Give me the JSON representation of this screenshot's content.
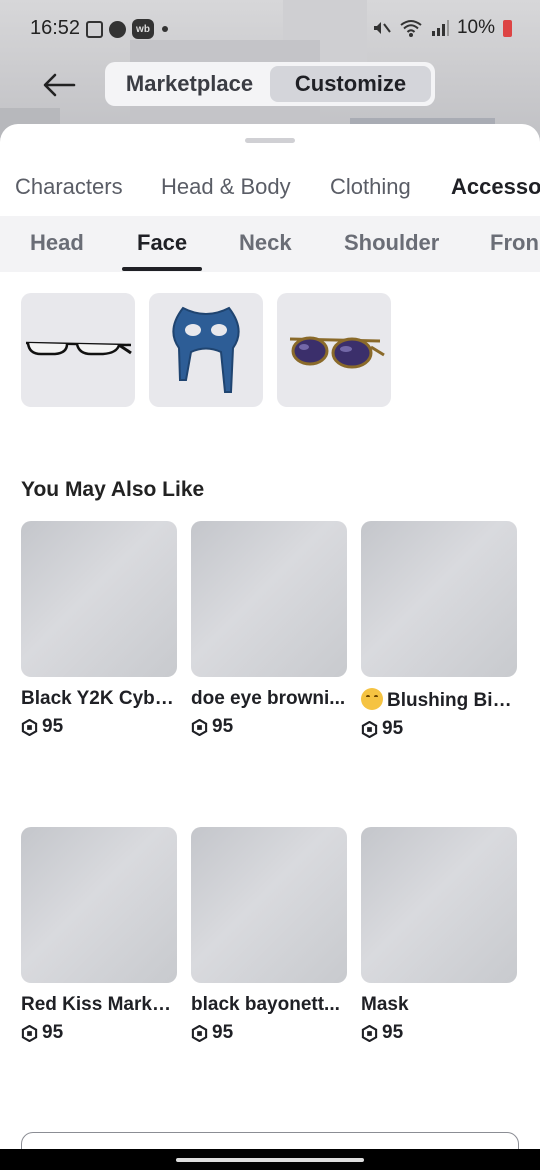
{
  "status_bar": {
    "time": "16:52",
    "notification_badge": "wb",
    "battery": "10%"
  },
  "header": {
    "segments": [
      "Marketplace",
      "Customize"
    ],
    "active_segment": "Customize"
  },
  "categories": [
    "Characters",
    "Head & Body",
    "Clothing",
    "Accesso"
  ],
  "subtabs": [
    "Head",
    "Face",
    "Neck",
    "Shoulder",
    "Fron"
  ],
  "owned_items": [
    {
      "icon": "glasses-icon"
    },
    {
      "icon": "mask-icon"
    },
    {
      "icon": "sunglasses-icon"
    }
  ],
  "recommendations": {
    "title": "You May Also Like",
    "items": [
      {
        "name": "Black Y2K Cybe...",
        "price": "95"
      },
      {
        "name": "doe eye browni...",
        "price": "95"
      },
      {
        "name": "Blushing Big ...",
        "price": "95"
      },
      {
        "name": "Red Kiss Marks ...",
        "price": "95"
      },
      {
        "name": "black bayonett...",
        "price": "95"
      },
      {
        "name": "Mask",
        "price": "95"
      }
    ]
  },
  "colors": {
    "sheet": "#ffffff",
    "tile": "#e8e8ec",
    "accent_text": "#1f2025",
    "mask_blue": "#2d5d96"
  }
}
